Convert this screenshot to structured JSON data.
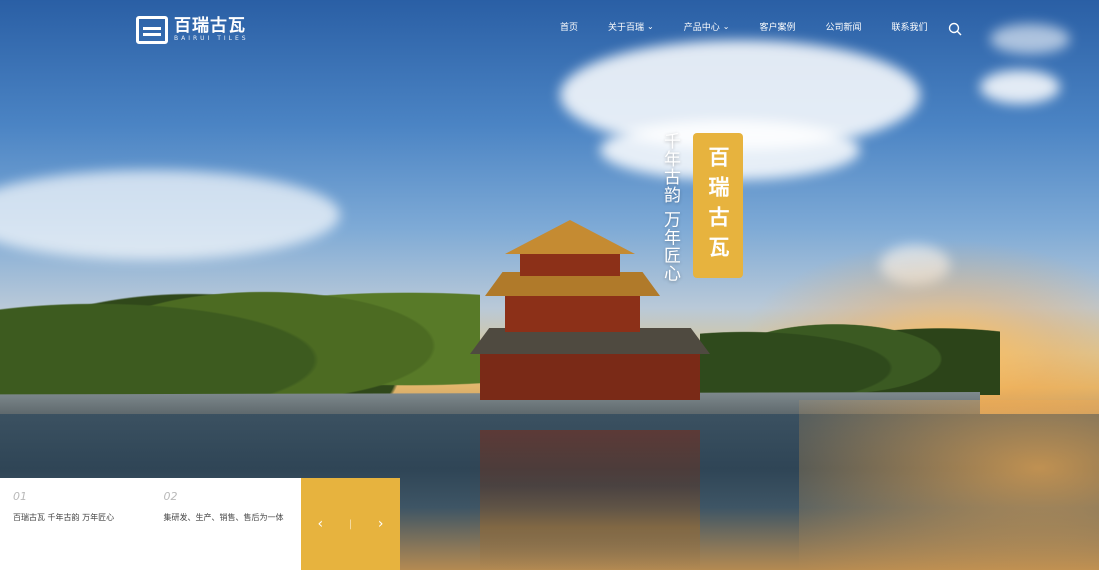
{
  "header": {
    "logo_cn": "百瑞古瓦",
    "logo_en": "BAIRUI TILES",
    "nav": [
      {
        "label": "首页",
        "has_dropdown": false
      },
      {
        "label": "关于百瑞",
        "has_dropdown": true
      },
      {
        "label": "产品中心",
        "has_dropdown": true
      },
      {
        "label": "客户案例",
        "has_dropdown": false
      },
      {
        "label": "公司新闻",
        "has_dropdown": false
      },
      {
        "label": "联系我们",
        "has_dropdown": false
      }
    ],
    "search_icon": "search-icon"
  },
  "hero": {
    "tagline_vertical": "千年古韵 万年匠心",
    "brand_badge": "百瑞古瓦"
  },
  "info_panel": {
    "items": [
      {
        "num": "01",
        "text": "百瑞古瓦 千年古韵 万年匠心"
      },
      {
        "num": "02",
        "text": "集研发、生产、销售、售后为一体"
      }
    ]
  },
  "slider": {
    "prev": "‹",
    "sep": "|",
    "next": "›"
  },
  "colors": {
    "accent": "#e7b33e",
    "panel_bg": "#ffffff"
  }
}
